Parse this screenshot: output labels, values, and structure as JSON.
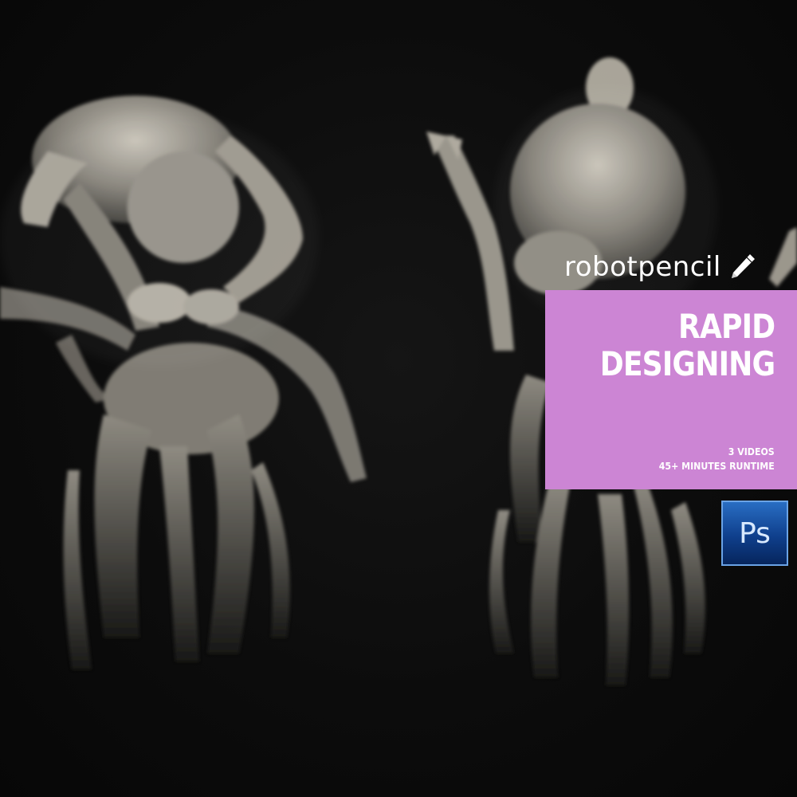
{
  "brand": {
    "logo_text": "robotpencil",
    "logo_icon": "pencil-icon"
  },
  "promo": {
    "title_line1": "RAPID",
    "title_line2": "DESIGNING",
    "detail_line1": "3 VIDEOS",
    "detail_line2": "45+ MINUTES RUNTIME",
    "accent_color": "#cc85d4"
  },
  "software_badge": {
    "label": "Ps",
    "icon": "photoshop-icon",
    "color": "#1b5fb5"
  },
  "background_color": "#0b0b0b"
}
